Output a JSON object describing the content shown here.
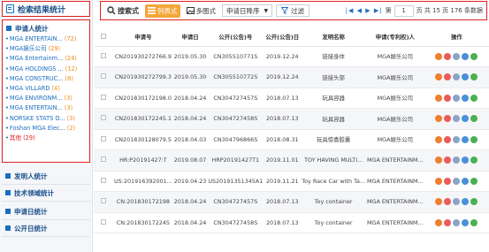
{
  "sidebar": {
    "header": "检索结果统计",
    "applicant_title": "申请人统计",
    "applicants": [
      {
        "name": "MGA ENTERTAIN...",
        "count": "(72)"
      },
      {
        "name": "MGA娱乐公司",
        "count": "(29)"
      },
      {
        "name": "MGA Entertainm...",
        "count": "(24)"
      },
      {
        "name": "MGA HOLDINGS ...",
        "count": "(12)"
      },
      {
        "name": "MGA CONSTRUC...",
        "count": "(8)"
      },
      {
        "name": "MGA VILLARD",
        "count": "(4)"
      },
      {
        "name": "MGA ENVIRONM...",
        "count": "(3)"
      },
      {
        "name": "MGA ENTERTAIN...",
        "count": "(3)"
      },
      {
        "name": "NORSKE STATS O...",
        "count": "(3)"
      },
      {
        "name": "Foshan MGA Elec...",
        "count": "(2)"
      }
    ],
    "other": {
      "name": "其他",
      "count": "(29)"
    },
    "sections": [
      "发明人统计",
      "技术领域统计",
      "申请日统计",
      "公开日统计"
    ]
  },
  "toolbar": {
    "search_mode": "搜索式",
    "list_mode": "列表式",
    "multi_mode": "多图式",
    "sort_select": "申请日降序",
    "filter": "过滤",
    "pager_arrows": "|◀ ◀ ▶ ▶|",
    "page_prefix": "第",
    "page_value": "1",
    "page_info": "页 共 15 页 176 条数据"
  },
  "table": {
    "headers": [
      "申请号",
      "申请日",
      "公开(公告)号",
      "公开(公告)日",
      "发明名称",
      "申请(专利权)人",
      "操作"
    ],
    "rows": [
      {
        "app_no": "CN201930272766.9",
        "app_date": "2019.05.30",
        "pub_no": "CN305510771S",
        "pub_date": "2019.12.24",
        "title": "链接身体",
        "applicant": "MGA娱乐公司"
      },
      {
        "app_no": "CN201930272799.3",
        "app_date": "2019.05.30",
        "pub_no": "CN305510772S",
        "pub_date": "2019.12.24",
        "title": "链接头部",
        "applicant": "MGA娱乐公司"
      },
      {
        "app_no": "CN201830172198.0",
        "app_date": "2018.04.24",
        "pub_no": "CN304727457S",
        "pub_date": "2018.07.13",
        "title": "玩具容器",
        "applicant": "MGA娱乐公司"
      },
      {
        "app_no": "CN201830172245.1",
        "app_date": "2018.04.24",
        "pub_no": "CN304727458S",
        "pub_date": "2018.07.13",
        "title": "玩具容器",
        "applicant": "MGA娱乐公司"
      },
      {
        "app_no": "CN201830128079.5",
        "app_date": "2018.04.03",
        "pub_no": "CN304796866S",
        "pub_date": "2018.08.31",
        "title": "玩具惊喜胶囊",
        "applicant": "MGA娱乐公司"
      },
      {
        "app_no": "HR:P20191427:T",
        "app_date": "2019.08.07",
        "pub_no": "HRP20191427T1",
        "pub_date": "2019.11.01",
        "title": "TOY HAVING MULTI...",
        "applicant": "MGA ENTERTAINM..."
      },
      {
        "app_no": "US:201916392001...",
        "app_date": "2019.04.23",
        "pub_no": "US20191351345A1",
        "pub_date": "2019.11.21",
        "title": "Toy Race Car with Ta...",
        "applicant": "MGA ENTERTAINM..."
      },
      {
        "app_no": "CN:201830172198",
        "app_date": "2018.04.24",
        "pub_no": "CN304727457S",
        "pub_date": "2018.07.13",
        "title": "Toy container",
        "applicant": "MGA ENTERTAINM..."
      },
      {
        "app_no": "CN:201830172245",
        "app_date": "2018.04.24",
        "pub_no": "CN304727458S",
        "pub_date": "2018.07.13",
        "title": "Toy container",
        "applicant": "MGA ENTERTAINM..."
      }
    ]
  }
}
